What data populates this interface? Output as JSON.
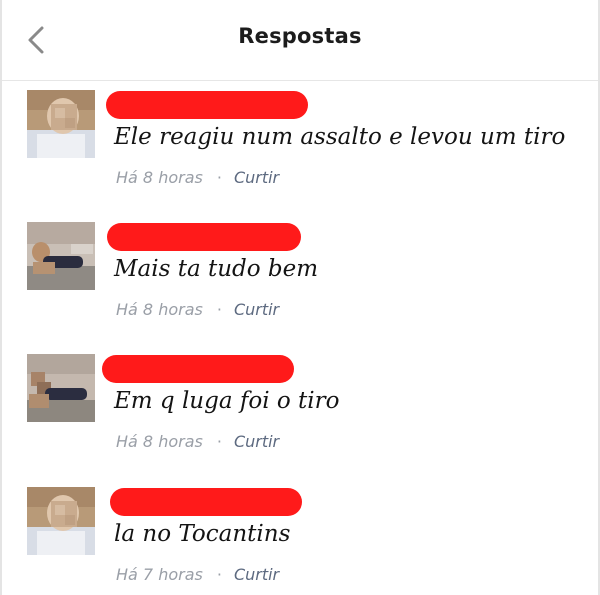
{
  "header": {
    "title": "Respostas",
    "back_icon": "chevron-left-icon"
  },
  "colors": {
    "redaction": "#ff1a1a",
    "time_text": "#9a9fa7",
    "like_text": "#5d6a80"
  },
  "separator": "·",
  "replies": [
    {
      "text": "Ele reagiu num assalto e levou um tiro",
      "time": "Há 8 horas",
      "like": "Curtir"
    },
    {
      "text": "Mais ta tudo bem",
      "time": "Há 8 horas",
      "like": "Curtir"
    },
    {
      "text": "Em q luga foi o tiro",
      "time": "Há 8 horas",
      "like": "Curtir"
    },
    {
      "text": "la no Tocantins",
      "time": "Há 7 horas",
      "like": "Curtir"
    }
  ]
}
